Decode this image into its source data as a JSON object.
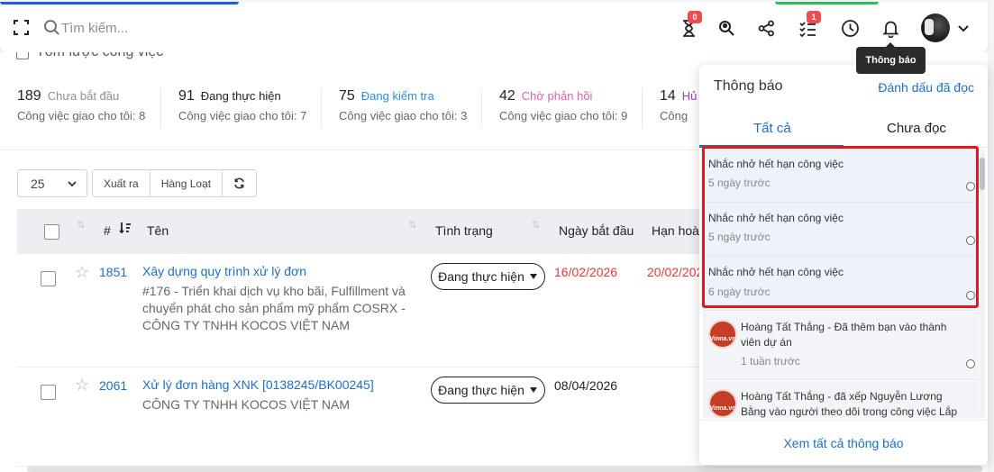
{
  "topbar": {
    "search_placeholder": "Tìm kiếm...",
    "icons": [
      "expand-icon",
      "search-icon",
      "hourglass-icon",
      "search-user-icon",
      "share-icon",
      "checklist-icon",
      "clock-icon",
      "bell-icon",
      "chevron-down-icon"
    ],
    "timer_badge": "0",
    "tasks_badge": "1",
    "tooltip": "Thông báo",
    "accent_colors": {
      "brand_blue": "#1d5fd8",
      "brand_green": "#2fbd5a",
      "badge_red": "#ef4b52"
    }
  },
  "summary": {
    "title": "Tóm lược công việc",
    "stats": [
      {
        "count": "189",
        "label": "Chưa bắt đầu",
        "sub": "Công việc giao cho tôi: 8",
        "color": "#8a8f96"
      },
      {
        "count": "91",
        "label": "Đang thực hiện",
        "sub": "Công việc giao cho tôi: 7",
        "color": "#222222"
      },
      {
        "count": "75",
        "label": "Đang kiểm tra",
        "sub": "Công việc giao cho tôi: 3",
        "color": "#2a8fd8"
      },
      {
        "count": "42",
        "label": "Chờ phản hồi",
        "sub": "Công việc giao cho tôi: 9",
        "color": "#e060b0"
      },
      {
        "count": "14",
        "label": "Hủ",
        "sub": "Công",
        "color": "#a03ac0"
      }
    ]
  },
  "toolbar": {
    "page_size": "25",
    "export_label": "Xuất ra",
    "bulk_label": "Hàng Loạt"
  },
  "table": {
    "headers": {
      "num": "#",
      "name": "Tên",
      "status": "Tình trạng",
      "start": "Ngày bắt đầu",
      "due": "Hạn hoàn thành"
    },
    "rows": [
      {
        "id": "1851",
        "title": "Xây dựng quy trình xử lý đơn",
        "desc": "#176 - Triển khai dịch vụ kho bãi, Fulfillment và chuyển phát cho sản phẩm mỹ phẩm COSRX - CÔNG TY TNHH KOCOS VIỆT NAM",
        "status": "Đang thực hiện",
        "start": "16/02/2026",
        "due": "20/02/2026",
        "start_color": "#e0393e",
        "due_color": "#e0393e"
      },
      {
        "id": "2061",
        "title": "Xử lý đơn hàng XNK [0138245/BK00245]",
        "desc": "CÔNG TY TNHH KOCOS VIỆT NAM",
        "status": "Đang thực hiện",
        "start": "08/04/2026",
        "due": "",
        "start_color": "#222222",
        "due_color": "#222222"
      }
    ]
  },
  "notifications": {
    "title": "Thông báo",
    "mark_all": "Đánh dấu đã đọc",
    "tab_all": "Tất cả",
    "tab_unread": "Chưa đọc",
    "items": [
      {
        "text": "Nhắc nhở hết hạn công việc",
        "time": "5 ngày trước"
      },
      {
        "text": "Nhắc nhở hết hạn công việc",
        "time": "5 ngày trước"
      },
      {
        "text": "Nhắc nhở hết hạn công việc",
        "time": "6 ngày trước"
      },
      {
        "text": "Hoàng Tất Thắng - Đã thêm bạn vào thành viên dự án",
        "time": "1 tuần trước",
        "logo": "Vinna.vn"
      },
      {
        "text": "Hoàng Tất Thắng - đã xếp Nguyễn Lương Bằng vào người theo dõi trong công việc Lắp",
        "time": "",
        "logo": "Vinna.vn"
      }
    ],
    "see_all": "Xem tất cả thông báo",
    "highlight_color": "#e1191e"
  }
}
